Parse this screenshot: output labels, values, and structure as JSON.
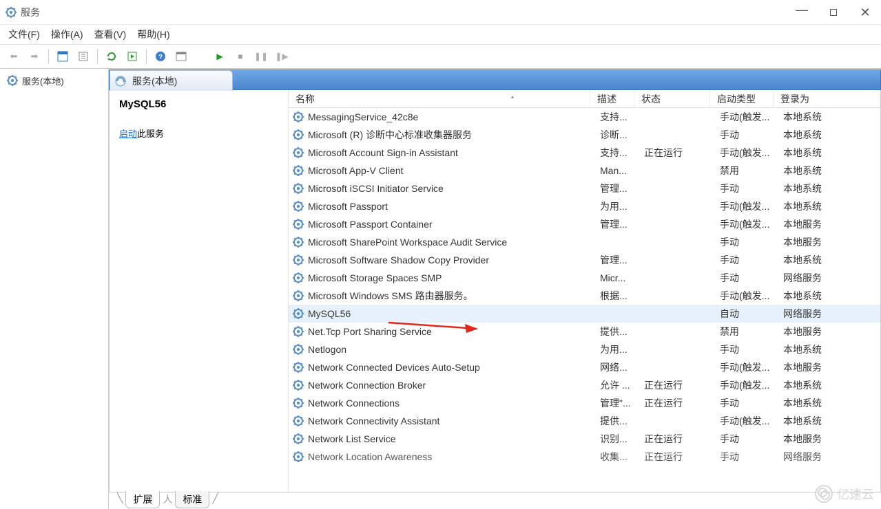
{
  "window": {
    "title": "服务",
    "min_tip": "最小化",
    "max_tip": "最大化",
    "close_tip": "关闭"
  },
  "menu": {
    "file": "文件(F)",
    "action": "操作(A)",
    "view": "查看(V)",
    "help": "帮助(H)"
  },
  "tree": {
    "root": "服务(本地)"
  },
  "panel": {
    "tab_label": "服务(本地)",
    "selected": "MySQL56",
    "action_prefix": "启动",
    "action_suffix": "此服务"
  },
  "columns": {
    "name": "名称",
    "desc": "描述",
    "status": "状态",
    "startup": "启动类型",
    "logon": "登录为"
  },
  "rows": [
    {
      "name": "MessagingService_42c8e",
      "desc": "支持...",
      "status": "",
      "startup": "手动(触发...",
      "logon": "本地系统"
    },
    {
      "name": "Microsoft (R) 诊断中心标准收集器服务",
      "desc": "诊断...",
      "status": "",
      "startup": "手动",
      "logon": "本地系统"
    },
    {
      "name": "Microsoft Account Sign-in Assistant",
      "desc": "支持...",
      "status": "正在运行",
      "startup": "手动(触发...",
      "logon": "本地系统"
    },
    {
      "name": "Microsoft App-V Client",
      "desc": "Man...",
      "status": "",
      "startup": "禁用",
      "logon": "本地系统"
    },
    {
      "name": "Microsoft iSCSI Initiator Service",
      "desc": "管理...",
      "status": "",
      "startup": "手动",
      "logon": "本地系统"
    },
    {
      "name": "Microsoft Passport",
      "desc": "为用...",
      "status": "",
      "startup": "手动(触发...",
      "logon": "本地系统"
    },
    {
      "name": "Microsoft Passport Container",
      "desc": "管理...",
      "status": "",
      "startup": "手动(触发...",
      "logon": "本地服务"
    },
    {
      "name": "Microsoft SharePoint Workspace Audit Service",
      "desc": "",
      "status": "",
      "startup": "手动",
      "logon": "本地服务"
    },
    {
      "name": "Microsoft Software Shadow Copy Provider",
      "desc": "管理...",
      "status": "",
      "startup": "手动",
      "logon": "本地系统"
    },
    {
      "name": "Microsoft Storage Spaces SMP",
      "desc": "Micr...",
      "status": "",
      "startup": "手动",
      "logon": "网络服务"
    },
    {
      "name": "Microsoft Windows SMS 路由器服务。",
      "desc": "根据...",
      "status": "",
      "startup": "手动(触发...",
      "logon": "本地系统"
    },
    {
      "name": "MySQL56",
      "desc": "",
      "status": "",
      "startup": "自动",
      "logon": "网络服务",
      "selected": true
    },
    {
      "name": "Net.Tcp Port Sharing Service",
      "desc": "提供...",
      "status": "",
      "startup": "禁用",
      "logon": "本地服务"
    },
    {
      "name": "Netlogon",
      "desc": "为用...",
      "status": "",
      "startup": "手动",
      "logon": "本地系统"
    },
    {
      "name": "Network Connected Devices Auto-Setup",
      "desc": "网络...",
      "status": "",
      "startup": "手动(触发...",
      "logon": "本地服务"
    },
    {
      "name": "Network Connection Broker",
      "desc": "允许 ...",
      "status": "正在运行",
      "startup": "手动(触发...",
      "logon": "本地系统"
    },
    {
      "name": "Network Connections",
      "desc": "管理\"...",
      "status": "正在运行",
      "startup": "手动",
      "logon": "本地系统"
    },
    {
      "name": "Network Connectivity Assistant",
      "desc": "提供...",
      "status": "",
      "startup": "手动(触发...",
      "logon": "本地系统"
    },
    {
      "name": "Network List Service",
      "desc": "识别...",
      "status": "正在运行",
      "startup": "手动",
      "logon": "本地服务"
    },
    {
      "name": "Network Location Awareness",
      "desc": "收集...",
      "status": "正在运行",
      "startup": "手动",
      "logon": "网络服务",
      "cut": true
    }
  ],
  "bottom_tabs": {
    "extended": "扩展",
    "standard": "标准"
  },
  "watermark": "亿速云"
}
